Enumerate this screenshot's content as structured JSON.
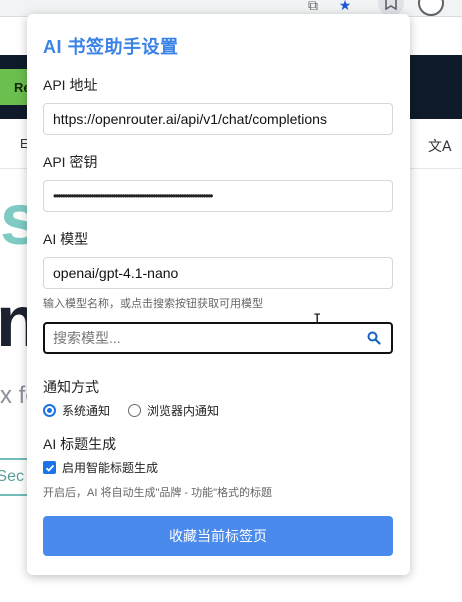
{
  "browser": {
    "background_text": {
      "nav_letter": "E",
      "green_button": "Re",
      "big_line_1": "s",
      "big_line_2": "nr",
      "small_line": "x fo",
      "sec_button": "Sec"
    },
    "icons": [
      "puzzle-icon",
      "star-icon",
      "extension-icon",
      "profile-icon",
      "translate-icon"
    ]
  },
  "popup": {
    "title": "AI 书签助手设置",
    "api_url": {
      "label": "API 地址",
      "value": "https://openrouter.ai/api/v1/chat/completions"
    },
    "api_key": {
      "label": "API 密钥",
      "value": "••••••••••••••••••••••••••••••••••••••••••••••••••••••••••••••••••••••••"
    },
    "model": {
      "label": "AI 模型",
      "value": "openai/gpt-4.1-nano",
      "hint": "输入模型名称，或点击搜索按钮获取可用模型",
      "search_placeholder": "搜索模型..."
    },
    "notify": {
      "label": "通知方式",
      "options": [
        {
          "label": "系统通知",
          "checked": true
        },
        {
          "label": "浏览器内通知",
          "checked": false
        }
      ]
    },
    "title_gen": {
      "label": "AI 标题生成",
      "checkbox_label": "启用智能标题生成",
      "checked": true,
      "hint": "开启后，AI 将自动生成\"品牌 - 功能\"格式的标题"
    },
    "save_button": "收藏当前标签页"
  },
  "colors": {
    "accent": "#3b82e6",
    "button": "#4a8aec",
    "radio": "#1a73e8"
  }
}
